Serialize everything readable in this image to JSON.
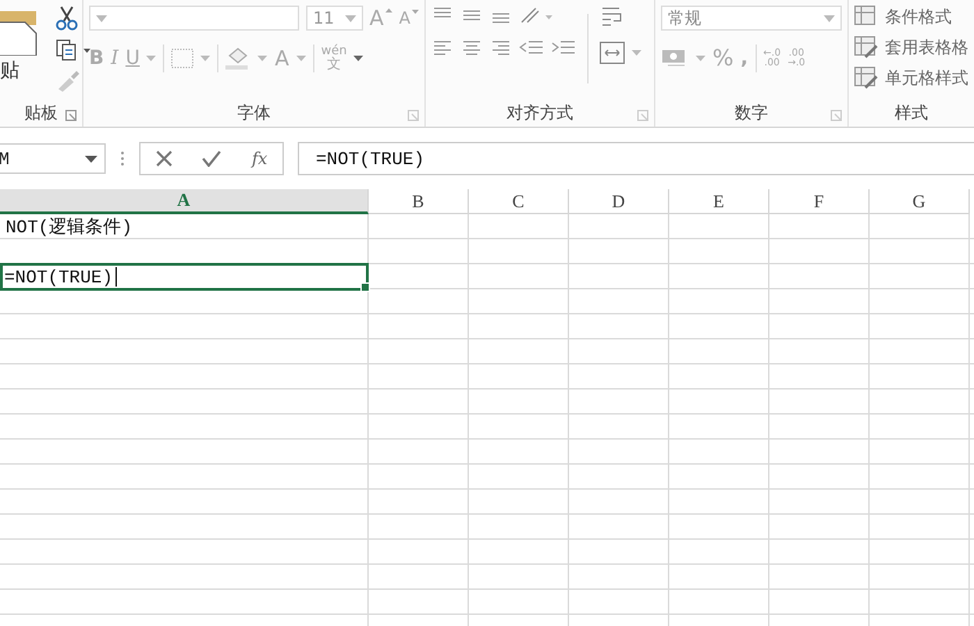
{
  "ribbon": {
    "clipboard": {
      "paste_label": "贴",
      "group_label": "贴板"
    },
    "font": {
      "size": "11",
      "bold": "B",
      "italic": "I",
      "underline": "U",
      "font_color": "A",
      "grow": "A",
      "shrink": "A",
      "phonetic_top": "wén",
      "phonetic_bottom": "文",
      "group_label": "字体"
    },
    "alignment": {
      "group_label": "对齐方式"
    },
    "number": {
      "format": "常规",
      "percent": "%",
      "comma": ",",
      "increase_decimal": [
        "←.0",
        ".00"
      ],
      "decrease_decimal": [
        ".00",
        "→.0"
      ],
      "group_label": "数字"
    },
    "styles": {
      "items": [
        "条件格式",
        "套用表格格",
        "单元格样式"
      ],
      "group_label": "样式"
    }
  },
  "formula_bar": {
    "name_box": "M",
    "fx": "fx",
    "formula": "=NOT(TRUE)"
  },
  "sheet": {
    "columns": [
      {
        "label": "A",
        "selected": true
      },
      {
        "label": "B",
        "selected": false
      },
      {
        "label": "C",
        "selected": false
      },
      {
        "label": "D",
        "selected": false
      },
      {
        "label": "E",
        "selected": false
      },
      {
        "label": "F",
        "selected": false
      },
      {
        "label": "G",
        "selected": false
      }
    ],
    "cells": [
      {
        "text": "NOT(逻辑条件)",
        "selected": false
      },
      {
        "selected": false
      },
      {
        "text": "=NOT(TRUE)",
        "selected": true
      }
    ]
  }
}
